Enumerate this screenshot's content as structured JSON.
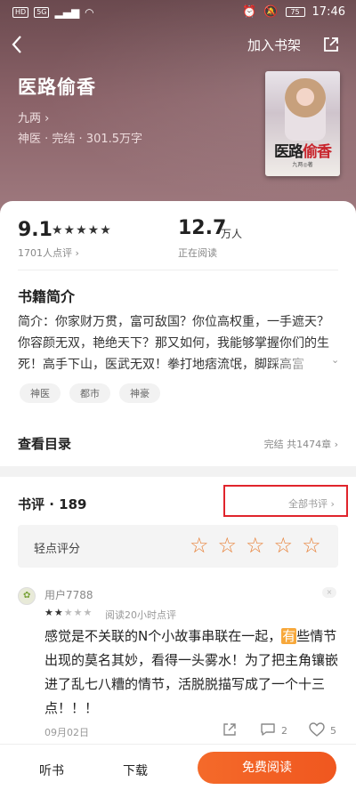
{
  "status_bar": {
    "left_chips": [
      "HD",
      "5G"
    ],
    "time": "17:46",
    "battery": "75"
  },
  "nav": {
    "back_icon": "back-arrow-icon",
    "add_to_shelf_label": "加入书架",
    "share_icon": "share-icon"
  },
  "book": {
    "title": "医路偷香",
    "author": "九两 ›",
    "meta": "神医 · 完结 · 301.5万字",
    "cover": {
      "title_part1": "医路",
      "title_part2": "偷香",
      "author_text": "九两◎著"
    }
  },
  "stats": {
    "score": "9.1",
    "score_stars": "★★★★★",
    "score_count": "1701人点评 ›",
    "reading_value": "12.7",
    "reading_unit": "万人",
    "reading_label": "正在阅读"
  },
  "intro": {
    "heading": "书籍简介",
    "text": "简介：你家财万贯，富可敌国？你位高权重，一手遮天？你容颜无双，艳绝天下？那又如何，我能够掌握你们的生死！高手下山，医武无双！拳打地痞流氓，脚踩高富帅……",
    "tags": [
      "神医",
      "都市",
      "神豪"
    ]
  },
  "catalog": {
    "label": "查看目录",
    "status": "完结 共1474章 ›"
  },
  "reviews": {
    "title": "书评 · 189",
    "all_label": "全部书评 ›",
    "rate_label": "轻点评分",
    "rate_star": "☆",
    "items": [
      {
        "user": "用户7788",
        "stars_on": "★★",
        "stars_off": "★★★",
        "meta": "阅读20小时点评",
        "text_before": "感觉是不关联的N个小故事串联在一起，",
        "text_highlight": "有",
        "text_after": "些情节出现的莫名其妙，看得一头雾水！为了把主角镶嵌进了乱七八糟的情节，活脱脱描写成了一个十三点！！！",
        "date": "09月02日",
        "comments": "2",
        "likes": "5"
      }
    ]
  },
  "bottom": {
    "listen_label": "听书",
    "download_label": "下载",
    "read_label": "免费阅读"
  },
  "colors": {
    "accent": "#f0571f",
    "highlight_box": "#e0242c",
    "star_outline": "#e8823a"
  }
}
